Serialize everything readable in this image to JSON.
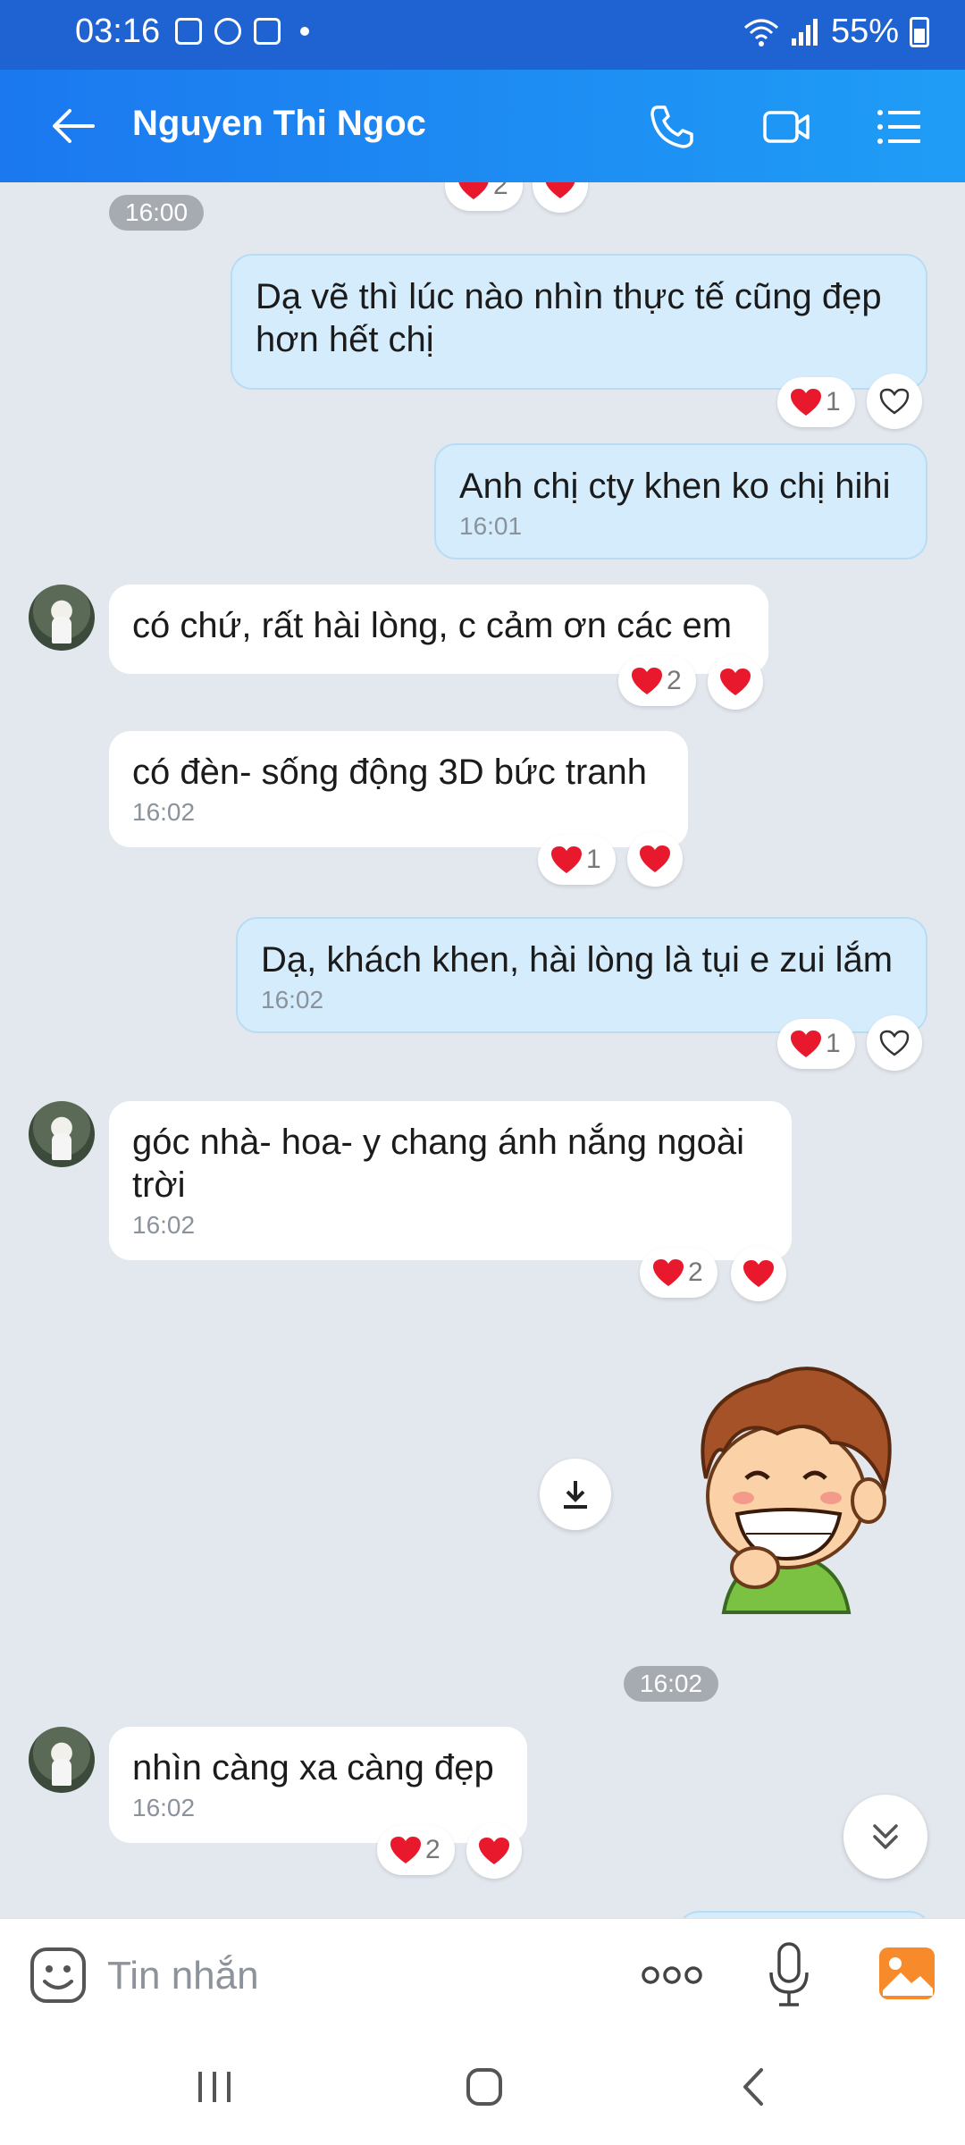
{
  "status_bar": {
    "time": "03:16",
    "battery": "55%"
  },
  "header": {
    "contact_name": "Nguyen Thi Ngoc"
  },
  "messages": {
    "m0": {
      "time": "16:00"
    },
    "m1": {
      "text": "Dạ vẽ thì lúc nào nhìn thực tế cũng đẹp hơn hết chị",
      "count": "1"
    },
    "m2": {
      "text": "Anh chị cty khen ko chị hihi",
      "time": "16:01"
    },
    "m3": {
      "text": "có chứ, rất hài lòng, c cảm ơn các em",
      "count": "2"
    },
    "m4": {
      "text": "có đèn- sống động 3D bức tranh",
      "time": "16:02",
      "count": "1"
    },
    "m5": {
      "text": "Dạ, khách khen, hài lòng là tụi e zui lắm",
      "time": "16:02",
      "count": "1"
    },
    "m6": {
      "text": "góc nhà- hoa- y chang ánh nắng ngoài trời",
      "time": "16:02",
      "count": "2"
    },
    "m7": {
      "time": "16:02"
    },
    "m8": {
      "text": "nhìn càng xa càng đẹp",
      "time": "16:02",
      "count": "2"
    },
    "top_partial_count": "2"
  },
  "input": {
    "placeholder": "Tin nhắn"
  },
  "colors": {
    "header": "#1b78ef",
    "outgoing_bubble": "#d4ecfc",
    "heart": "#e8192c"
  }
}
